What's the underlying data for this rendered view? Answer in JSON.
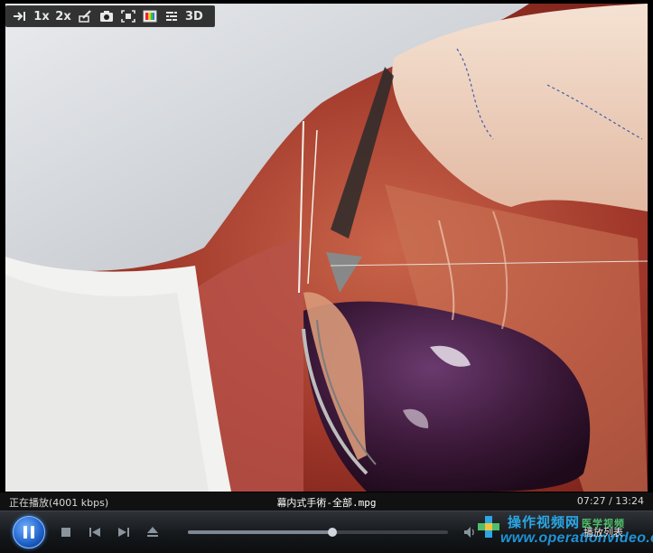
{
  "window": {
    "background": "#000000",
    "accent": "#1e5fc7"
  },
  "toolbar": {
    "items": [
      {
        "name": "pin-icon",
        "label": ""
      },
      {
        "name": "speed-1x",
        "label": "1x"
      },
      {
        "name": "speed-2x",
        "label": "2x"
      },
      {
        "name": "edit-icon",
        "label": ""
      },
      {
        "name": "camera-icon",
        "label": ""
      },
      {
        "name": "fullscreen-icon",
        "label": ""
      },
      {
        "name": "color-adjust-icon",
        "label": ""
      },
      {
        "name": "equalizer-icon",
        "label": ""
      },
      {
        "name": "mode-3d",
        "label": "3D"
      }
    ]
  },
  "status": {
    "state": "正在播放(4001 kbps)",
    "filename": "幕内式手術-全部.mpg",
    "time": "07:27 / 13:24"
  },
  "playback": {
    "progress": 0.556,
    "play_state": "pause-icon"
  },
  "branding": {
    "cn_name": "操作视频网",
    "cn_sub": "医学视频",
    "url": "www.operationvideo.com",
    "playlist_label": "播放列表"
  }
}
